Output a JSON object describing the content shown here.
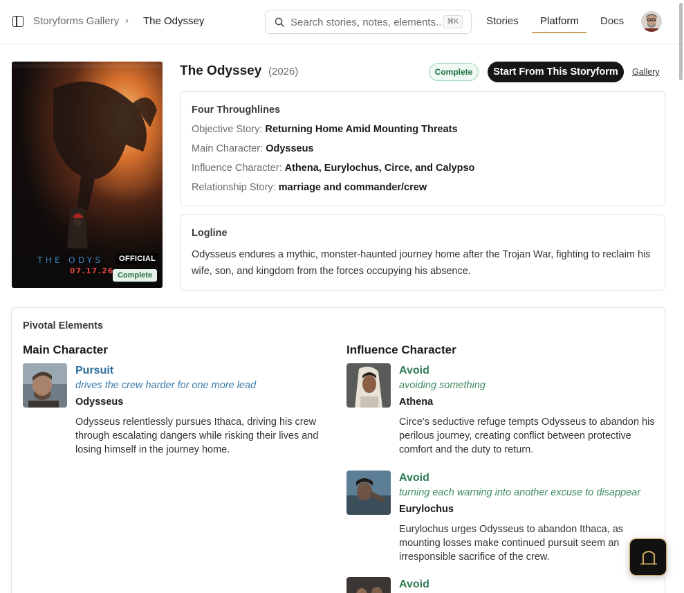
{
  "header": {
    "breadcrumb_parent": "Storyforms Gallery",
    "breadcrumb_separator": "›",
    "breadcrumb_current": "The Odyssey",
    "search_placeholder": "Search stories, notes, elements...",
    "search_shortcut": "⌘K",
    "nav": [
      {
        "label": "Stories",
        "active": false
      },
      {
        "label": "Platform",
        "active": true
      },
      {
        "label": "Docs",
        "active": false
      }
    ],
    "accent_color": "#c9a25a"
  },
  "poster": {
    "title_text": "THE ODYS",
    "date_text": "07.17.26",
    "official_label": "OFFICIAL",
    "status_badge": "Complete"
  },
  "story": {
    "title": "The Odyssey",
    "year": "(2026)",
    "status": "Complete",
    "cta_label": "Start From This Storyform",
    "gallery_link": "Gallery"
  },
  "throughlines": {
    "heading": "Four Throughlines",
    "rows": [
      {
        "label": "Objective Story:",
        "value": "Returning Home Amid Mounting Threats"
      },
      {
        "label": "Main Character:",
        "value": "Odysseus"
      },
      {
        "label": "Influence Character:",
        "value": "Athena, Eurylochus, Circe, and Calypso"
      },
      {
        "label": "Relationship Story:",
        "value": "marriage and commander/crew"
      }
    ]
  },
  "logline": {
    "heading": "Logline",
    "text": "Odysseus endures a mythic, monster-haunted journey home after the Trojan War, fighting to reclaim his wife, son, and kingdom from the forces occupying his absence."
  },
  "pivotal": {
    "heading": "Pivotal Elements",
    "main_character": {
      "heading": "Main Character",
      "items": [
        {
          "element": "Pursuit",
          "subtitle": "drives the crew harder for one more lead",
          "character": "Odysseus",
          "description": "Odysseus relentlessly pursues Ithaca, driving his crew through escalating dangers while risking their lives and losing himself in the journey home."
        }
      ]
    },
    "influence_character": {
      "heading": "Influence Character",
      "items": [
        {
          "element": "Avoid",
          "subtitle": "avoiding something",
          "character": "Athena",
          "description": "Circe's seductive refuge tempts Odysseus to abandon his perilous journey, creating conflict between protective comfort and the duty to return."
        },
        {
          "element": "Avoid",
          "subtitle": "turning each warning into another excuse to disappear",
          "character": "Eurylochus",
          "description": "Eurylochus urges Odysseus to abandon Ithaca, as mounting losses make continued pursuit seem an irresponsible sacrifice of the crew."
        },
        {
          "element": "Avoid"
        }
      ]
    }
  },
  "colors": {
    "main_element": "#2b6e9c",
    "influence_element": "#2f7c55",
    "complete_badge": "#1f6e44"
  }
}
